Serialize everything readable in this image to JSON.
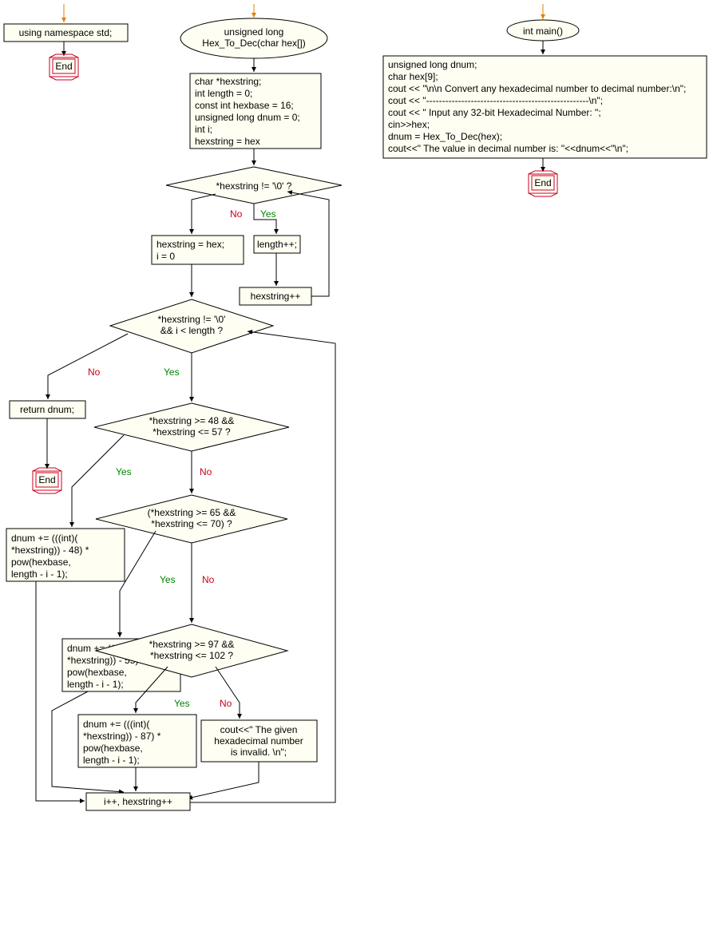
{
  "col1": {
    "entry": "using namespace std;",
    "end": "End"
  },
  "col2": {
    "func": "unsigned long\nHex_To_Dec(char hex[])",
    "init": "char *hexstring;\nint length = 0;\nconst int hexbase = 16;\nunsigned long dnum = 0;\nint i;\nhexstring = hex",
    "cond1": "*hexstring != '\\0' ?",
    "inc_len": "length++;",
    "inc_ptr": "hexstring++",
    "reset": "hexstring = hex;\ni = 0",
    "cond2": "*hexstring != '\\0'\n&& i < length ?",
    "return": "return dnum;",
    "end": "End",
    "cond3": "*hexstring >= 48 &&\n*hexstring <= 57 ?",
    "cond4": "(*hexstring >= 65 &&\n*hexstring <= 70) ?",
    "cond5": "*hexstring >= 97 &&\n*hexstring <= 102 ?",
    "calc1": "dnum += (((int)(\n*hexstring)) - 48) *\npow(hexbase,\nlength - i - 1);",
    "calc2": "dnum += (((int)(\n*hexstring)) - 55) *\npow(hexbase,\nlength - i - 1);",
    "calc3": "dnum += (((int)(\n*hexstring)) - 87) *\npow(hexbase,\nlength - i - 1);",
    "invalid": "cout<<\" The given\nhexadecimal number\nis invalid. \\n\";",
    "iter": "i++, hexstring++",
    "yes": "Yes",
    "no": "No"
  },
  "col3": {
    "func": "int main()",
    "body": "unsigned long dnum;\nchar hex[9];\ncout << \"\\n\\n Convert any hexadecimal number to decimal number:\\n\";\ncout << \"---------------------------------------------------\\n\";\ncout << \" Input any 32-bit Hexadecimal Number: \";\ncin>>hex;\ndnum = Hex_To_Dec(hex);\ncout<<\" The value in decimal number is: \"<<dnum<<\"\\n\";",
    "end": "End"
  }
}
